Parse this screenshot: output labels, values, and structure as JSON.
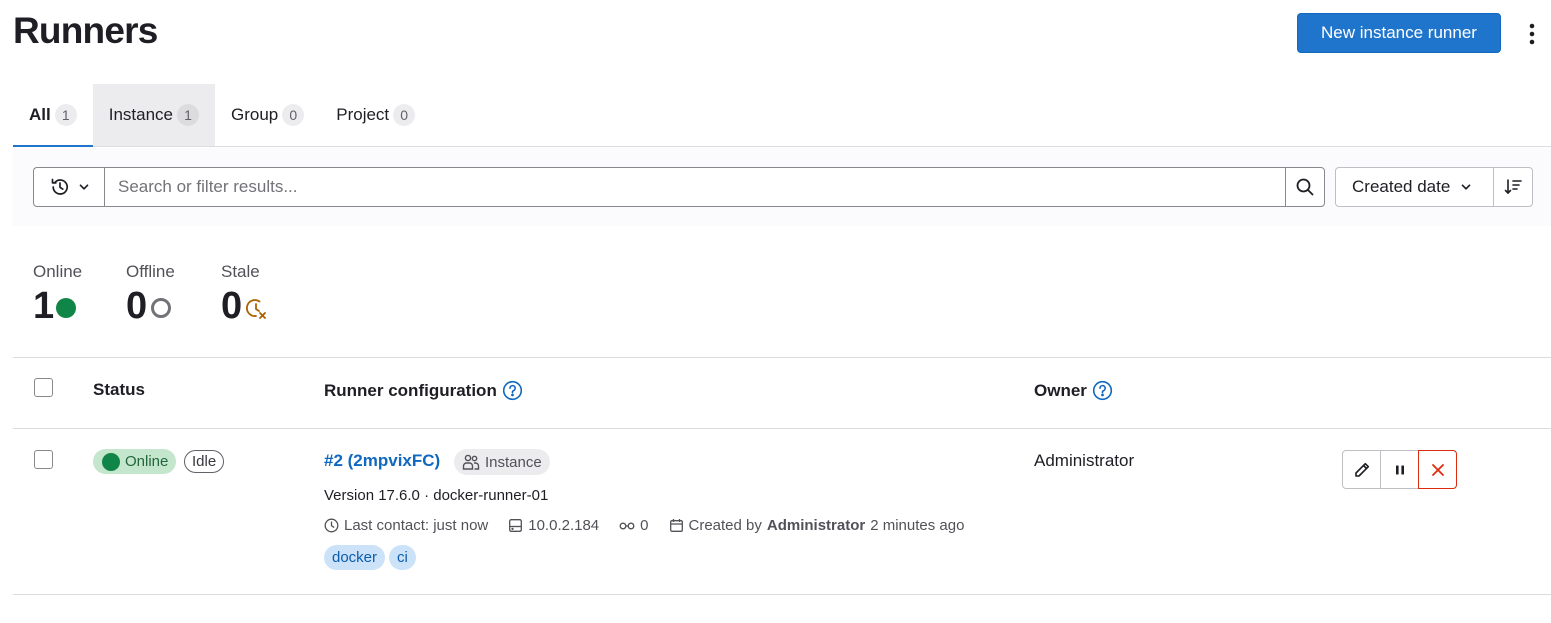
{
  "header": {
    "title": "Runners",
    "new_runner_label": "New instance runner",
    "more_actions_icon": "kebab-icon"
  },
  "tabs": [
    {
      "label": "All",
      "count": "1",
      "active": true
    },
    {
      "label": "Instance",
      "count": "1"
    },
    {
      "label": "Group",
      "count": "0"
    },
    {
      "label": "Project",
      "count": "0"
    }
  ],
  "filter": {
    "placeholder": "Search or filter results...",
    "sort_label": "Created date",
    "history_icon": "history-icon",
    "search_icon": "search-icon",
    "sort_direction_icon": "sort-lowest-icon"
  },
  "stats": [
    {
      "label": "Online",
      "value": "1",
      "icon": "status-online-dot",
      "color": "#108548"
    },
    {
      "label": "Offline",
      "value": "0",
      "icon": "status-offline-ring",
      "color": "#737278"
    },
    {
      "label": "Stale",
      "value": "0",
      "icon": "status-stale-clock",
      "color": "#ab6100"
    }
  ],
  "table": {
    "headers": {
      "status": "Status",
      "runner_configuration": "Runner configuration",
      "owner": "Owner"
    },
    "rows": [
      {
        "status": "Online",
        "state": "Idle",
        "runner_link": "#2 (2mpvixFC)",
        "type_badge": "Instance",
        "version_line": "Version 17.6.0 · docker-runner-01",
        "last_contact": "Last contact: just now",
        "ip_address": "10.0.2.184",
        "jobs_count": "0",
        "created_prefix": "Created by",
        "created_by": "Administrator",
        "created_when": "2 minutes ago",
        "tags": [
          "docker",
          "ci"
        ],
        "owner": "Administrator"
      }
    ]
  },
  "colors": {
    "primary": "#1f75cb",
    "link": "#1068bf",
    "online": "#108548",
    "danger": "#dd2b0e",
    "stale": "#ab6100"
  }
}
